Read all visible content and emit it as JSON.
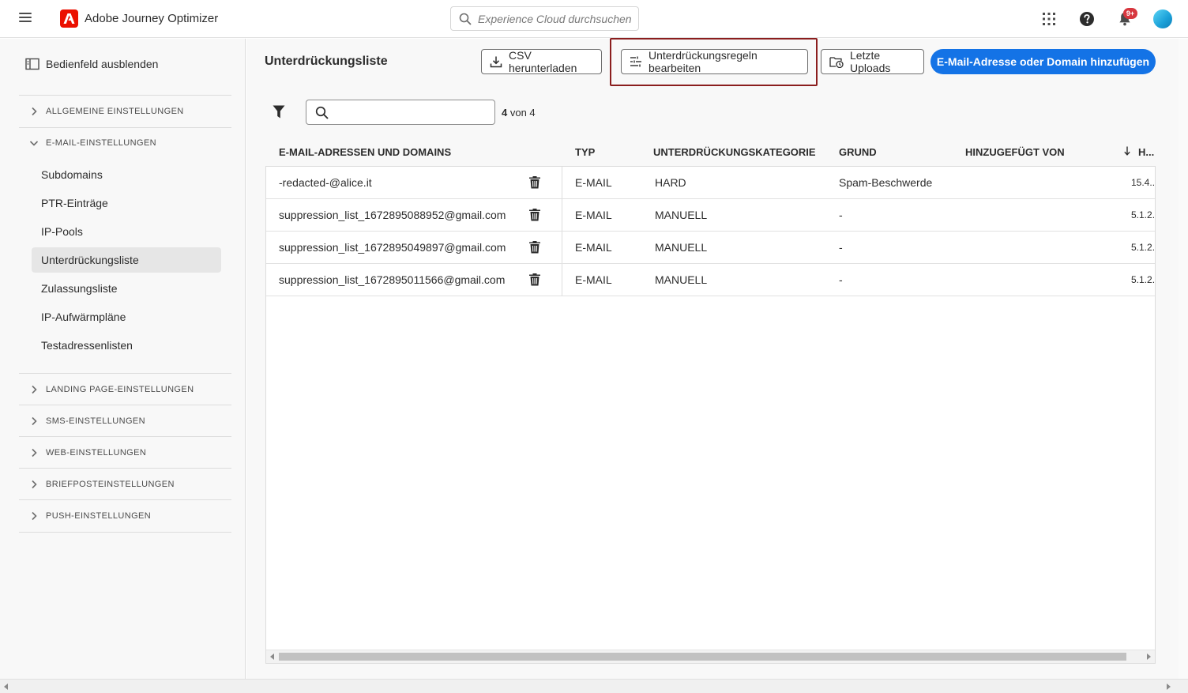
{
  "app": {
    "title": "Adobe Journey Optimizer"
  },
  "search": {
    "placeholder": "Experience Cloud durchsuchen ..."
  },
  "header": {
    "notification_count": "9+"
  },
  "sidebar": {
    "toggle_label": "Bedienfeld ausblenden",
    "sections": [
      {
        "label": "ALLGEMEINE EINSTELLUNGEN",
        "expanded": false
      },
      {
        "label": "E-MAIL-EINSTELLUNGEN",
        "expanded": true
      },
      {
        "label": "LANDING PAGE-EINSTELLUNGEN",
        "expanded": false
      },
      {
        "label": "SMS-EINSTELLUNGEN",
        "expanded": false
      },
      {
        "label": "WEB-EINSTELLUNGEN",
        "expanded": false
      },
      {
        "label": "BRIEFPOSTEINSTELLUNGEN",
        "expanded": false
      },
      {
        "label": "PUSH-EINSTELLUNGEN",
        "expanded": false
      }
    ],
    "email_items": [
      {
        "label": "Subdomains"
      },
      {
        "label": "PTR-Einträge"
      },
      {
        "label": "IP-Pools"
      },
      {
        "label": "Unterdrückungsliste",
        "active": true
      },
      {
        "label": "Zulassungsliste"
      },
      {
        "label": "IP-Aufwärmpläne"
      },
      {
        "label": "Testadressenlisten"
      }
    ]
  },
  "main": {
    "title": "Unterdrückungsliste",
    "buttons": {
      "csv": "CSV herunterladen",
      "rules": "Unterdrückungsregeln bearbeiten",
      "uploads": "Letzte Uploads",
      "add": "E-Mail-Adresse oder Domain hinzufügen"
    },
    "count_value": "4",
    "count_suffix": "von 4",
    "list_search": {
      "placeholder": ""
    }
  },
  "table": {
    "columns": [
      "E-MAIL-ADRESSEN UND DOMAINS",
      "TYP",
      "UNTERDRÜCKUNGSKATEGORIE",
      "GRUND",
      "HINZUGEFÜGT VON",
      "H..."
    ],
    "rows": [
      {
        "email": "-redacted-@alice.it",
        "type": "E-MAIL",
        "category": "HARD",
        "reason": "Spam-Beschwerde",
        "added_by": "",
        "date": "15.4..."
      },
      {
        "email": "suppression_list_1672895088952@gmail.com",
        "type": "E-MAIL",
        "category": "MANUELL",
        "reason": "-",
        "added_by": "",
        "date": "5.1.2..."
      },
      {
        "email": "suppression_list_1672895049897@gmail.com",
        "type": "E-MAIL",
        "category": "MANUELL",
        "reason": "-",
        "added_by": "",
        "date": "5.1.2..."
      },
      {
        "email": "suppression_list_1672895011566@gmail.com",
        "type": "E-MAIL",
        "category": "MANUELL",
        "reason": "-",
        "added_by": "",
        "date": "5.1.2..."
      }
    ]
  },
  "colors": {
    "accent": "#1473e6",
    "brand": "#eb1000",
    "highlight": "#8b1e1e",
    "badge": "#d7373f"
  },
  "icons": {
    "menu": "hamburger-icon",
    "logo": "adobe-logo-icon",
    "search": "search-icon",
    "apps": "app-grid-icon",
    "help": "help-icon",
    "notifications": "bell-icon",
    "panel": "panel-icon",
    "chevron_right": "chevron-right-icon",
    "chevron_down": "chevron-down-icon",
    "download": "download-icon",
    "rules": "sliders-icon",
    "uploads": "upload-history-icon",
    "filter": "filter-icon",
    "delete": "trash-icon",
    "sort": "sort-descending-icon"
  }
}
